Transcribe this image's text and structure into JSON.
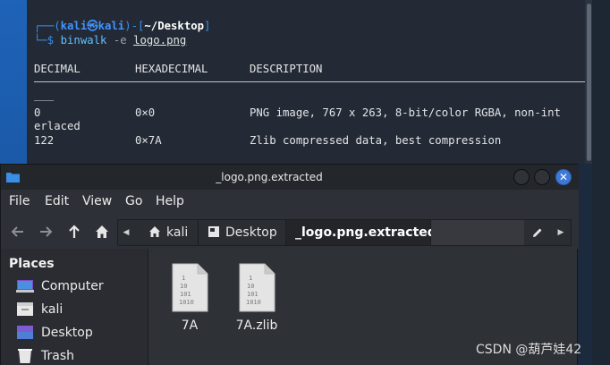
{
  "terminal": {
    "prompt_open": "┌──(",
    "user": "kali",
    "at_symbol": "㉿",
    "host": "kali",
    "path_open": ")-[",
    "path": "~/Desktop",
    "path_close": "]",
    "prompt_line2": "└─$ ",
    "command": "binwalk",
    "flag": "-e",
    "argument": "logo.png",
    "headers": {
      "decimal": "DECIMAL",
      "hex": "HEXADECIMAL",
      "desc": "DESCRIPTION"
    },
    "rows": [
      {
        "decimal": "0",
        "hex": "0×0",
        "desc": "PNG image, 767 x 263, 8-bit/color RGBA, non-int"
      },
      {
        "decimal": "122",
        "hex": "0×7A",
        "desc": "Zlib compressed data, best compression"
      }
    ],
    "wrap_text": "erlaced",
    "underscore": "___"
  },
  "file_manager": {
    "title": "_logo.png.extracted",
    "menu": [
      "File",
      "Edit",
      "View",
      "Go",
      "Help"
    ],
    "path_segments": [
      "kali",
      "Desktop",
      "_logo.png.extracted"
    ],
    "sidebar": {
      "heading": "Places",
      "items": [
        "Computer",
        "kali",
        "Desktop",
        "Trash"
      ]
    },
    "files": [
      {
        "name": "7A",
        "icon": "binary-file-icon"
      },
      {
        "name": "7A.zlib",
        "icon": "binary-file-icon"
      }
    ],
    "binary_glyph": [
      "1",
      "10",
      "101",
      "1010"
    ],
    "close_glyph": "✕"
  },
  "watermark": "CSDN @葫芦娃42",
  "colors": {
    "terminal_bg": "#232a36",
    "prompt_blue": "#3a8ee6",
    "command_cyan": "#5ec0ff",
    "window_bg": "#2d3036",
    "close_button": "#3f79d6"
  }
}
